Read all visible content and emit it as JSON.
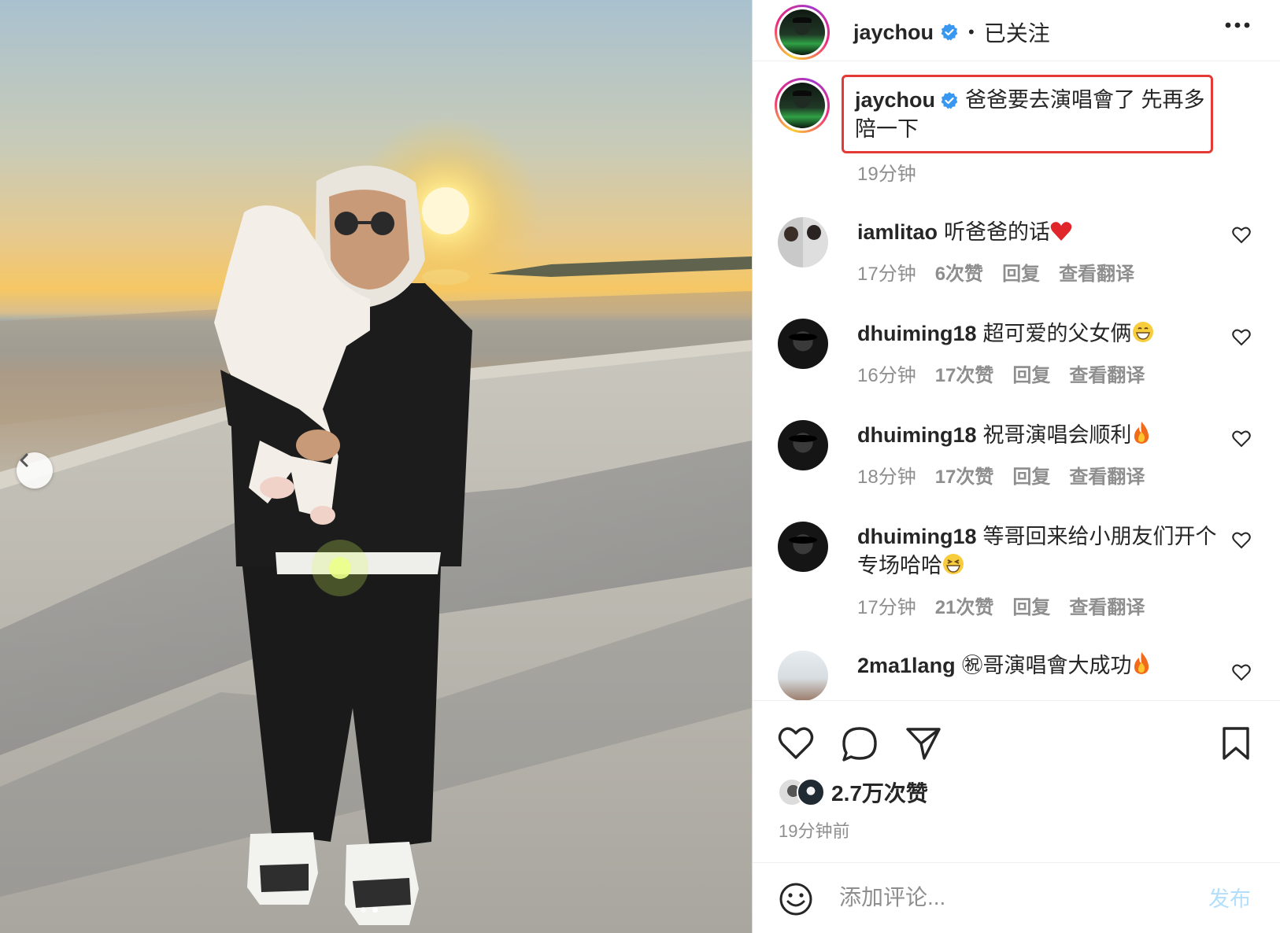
{
  "post": {
    "username": "jaychou",
    "follow_separator": "•",
    "follow_status": "已关注",
    "caption": "爸爸要去演唱會了 先再多陪一下",
    "caption_time": "19分钟",
    "likes": "2.7万次赞",
    "posted_ago": "19分钟前",
    "carousel_index": 2,
    "carousel_total": 2
  },
  "comments": [
    {
      "username": "iamlitao",
      "text": "听爸爸的话",
      "emoji": "heart",
      "time": "17分钟",
      "likes": "6次赞",
      "reply": "回复",
      "translate": "查看翻译"
    },
    {
      "username": "dhuiming18",
      "text": "超可爱的父女俩",
      "emoji": "grin",
      "time": "16分钟",
      "likes": "17次赞",
      "reply": "回复",
      "translate": "查看翻译"
    },
    {
      "username": "dhuiming18",
      "text": "祝哥演唱会顺利",
      "emoji": "fire",
      "time": "18分钟",
      "likes": "17次赞",
      "reply": "回复",
      "translate": "查看翻译"
    },
    {
      "username": "dhuiming18",
      "text": "等哥回来给小朋友们开个专场哈哈",
      "emoji": "laugh",
      "time": "17分钟",
      "likes": "21次赞",
      "reply": "回复",
      "translate": "查看翻译"
    },
    {
      "username": "2ma1lang",
      "text": "㊗哥演唱會大成功",
      "emoji": "fire",
      "time": "",
      "likes": "",
      "reply": "",
      "translate": ""
    }
  ],
  "comment_bar": {
    "placeholder": "添加评论...",
    "post_label": "发布"
  },
  "colors": {
    "verified": "#3897f0",
    "highlight_box": "#e53935",
    "secondary_text": "#8e8e8e",
    "post_disabled": "#b2dffc"
  },
  "icons": {
    "header_more": "more-horizontal-icon",
    "like": "heart-outline-icon",
    "comment": "speech-bubble-icon",
    "share": "paper-plane-icon",
    "save": "bookmark-icon",
    "emoji": "smiley-icon",
    "carousel_prev": "chevron-left-icon"
  }
}
